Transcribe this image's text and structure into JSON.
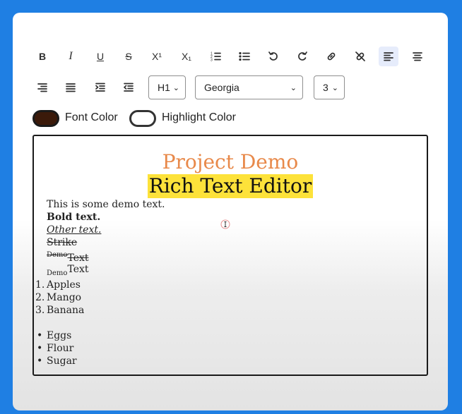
{
  "toolbar": {
    "buttons": [
      {
        "name": "bold",
        "icon": "bold-icon",
        "label": "B"
      },
      {
        "name": "italic",
        "icon": "italic-icon",
        "label": "I"
      },
      {
        "name": "underline",
        "icon": "underline-icon",
        "label": "U"
      },
      {
        "name": "strikethrough",
        "icon": "strikethrough-icon",
        "label": "S"
      },
      {
        "name": "superscript",
        "icon": "superscript-icon",
        "label": "X¹"
      },
      {
        "name": "subscript",
        "icon": "subscript-icon",
        "label": "X₁"
      },
      {
        "name": "ordered-list",
        "icon": "ordered-list-icon"
      },
      {
        "name": "bullet-list",
        "icon": "bullet-list-icon"
      },
      {
        "name": "undo",
        "icon": "undo-icon"
      },
      {
        "name": "redo",
        "icon": "redo-icon"
      },
      {
        "name": "link",
        "icon": "link-icon"
      },
      {
        "name": "unlink",
        "icon": "unlink-icon"
      },
      {
        "name": "align-left",
        "icon": "align-left-icon",
        "active": true
      },
      {
        "name": "align-center",
        "icon": "align-center-icon"
      },
      {
        "name": "align-right",
        "icon": "align-right-icon"
      },
      {
        "name": "align-justify",
        "icon": "align-justify-icon"
      },
      {
        "name": "indent",
        "icon": "indent-icon"
      },
      {
        "name": "outdent",
        "icon": "outdent-icon"
      }
    ],
    "heading_select": {
      "value": "H1"
    },
    "font_select": {
      "value": "Georgia"
    },
    "size_select": {
      "value": "3"
    },
    "font_color_label": "Font Color",
    "font_color_value": "#3b1a0a",
    "highlight_color_label": "Highlight Color",
    "highlight_color_value": "#ffffff"
  },
  "editor": {
    "title_line1": "Project Demo",
    "title_line1_color": "#e8894a",
    "title_line2": "Rich Text Editor",
    "title_line2_highlight": "#fde23a",
    "lines": {
      "plain": "This is some demo text.",
      "bold": "Bold text.",
      "italic": "Other text.",
      "strike": "Strike",
      "sup_base": "Demo",
      "sup_text": "Text",
      "sub_base": "Demo",
      "sub_text": "Text"
    },
    "ordered_list": [
      "Apples",
      "Mango",
      "Banana"
    ],
    "ordered_markers": [
      "1.",
      "2.",
      "3."
    ],
    "bullet_list": [
      "Eggs",
      "Flour",
      "Sugar"
    ],
    "bullet_marker": "•"
  },
  "colors": {
    "background": "#1f7fe3",
    "active_button": "#e6ecfb"
  }
}
